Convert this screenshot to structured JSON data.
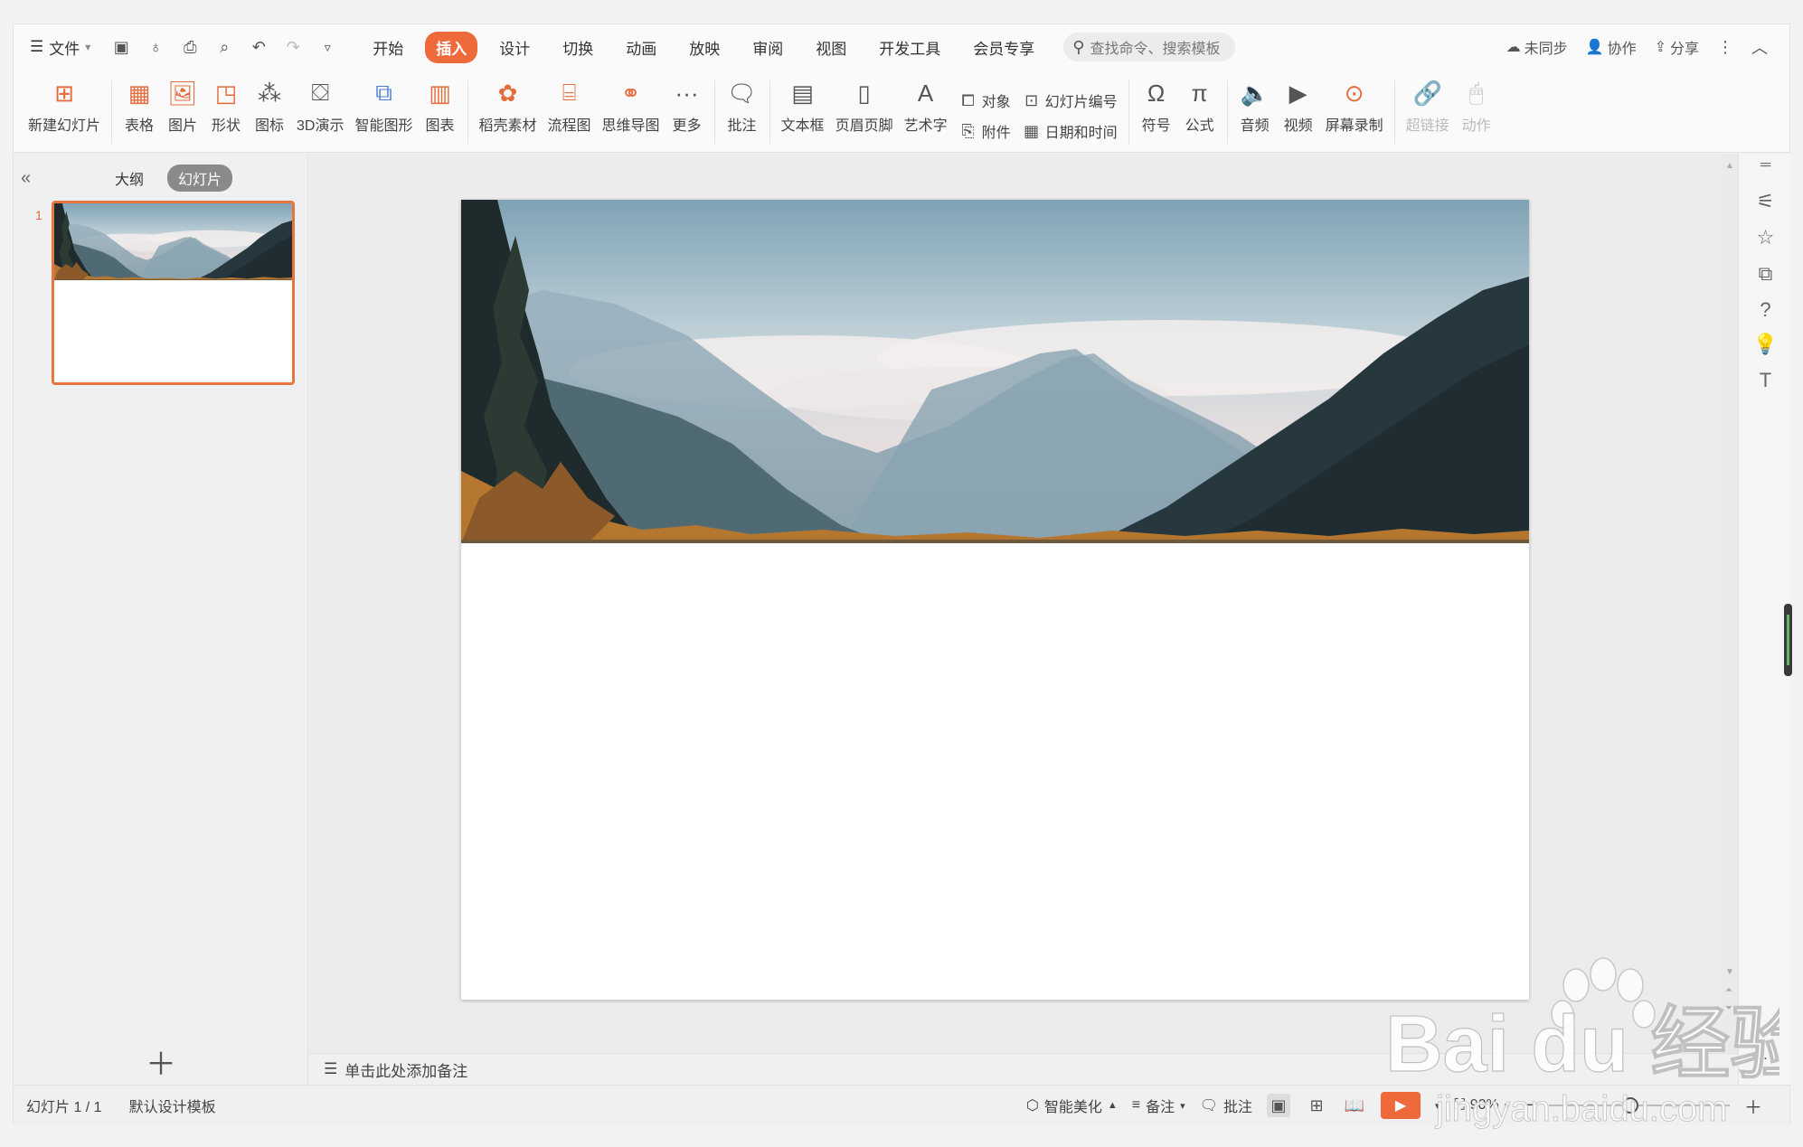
{
  "menu": {
    "file": "文件",
    "tabs": [
      {
        "label": "开始",
        "active": false
      },
      {
        "label": "插入",
        "active": true
      },
      {
        "label": "设计",
        "active": false
      },
      {
        "label": "切换",
        "active": false
      },
      {
        "label": "动画",
        "active": false
      },
      {
        "label": "放映",
        "active": false
      },
      {
        "label": "审阅",
        "active": false
      },
      {
        "label": "视图",
        "active": false
      },
      {
        "label": "开发工具",
        "active": false
      },
      {
        "label": "会员专享",
        "active": false
      }
    ],
    "search_placeholder": "查找命令、搜索模板",
    "sync": "未同步",
    "collab": "协作",
    "share": "分享"
  },
  "ribbon": {
    "new_slide": "新建幻灯片",
    "table": "表格",
    "picture": "图片",
    "shape": "形状",
    "icons": "图标",
    "demo3d": "3D演示",
    "smartart": "智能图形",
    "chart": "图表",
    "material": "稻壳素材",
    "flowchart": "流程图",
    "mindmap": "思维导图",
    "more": "更多",
    "comment": "批注",
    "textbox": "文本框",
    "header_footer": "页眉页脚",
    "wordart": "艺术字",
    "object": "对象",
    "attachment": "附件",
    "slide_number": "幻灯片编号",
    "datetime": "日期和时间",
    "symbol": "符号",
    "formula": "公式",
    "audio": "音频",
    "video": "视频",
    "screen_record": "屏幕录制",
    "hyperlink": "超链接",
    "action": "动作"
  },
  "left_panel": {
    "outline_tab": "大纲",
    "slides_tab": "幻灯片",
    "slide_number": "1"
  },
  "notes": {
    "placeholder": "单击此处添加备注"
  },
  "status": {
    "slide_counter": "幻灯片 1 / 1",
    "template": "默认设计模板",
    "beautify": "智能美化",
    "notes": "备注",
    "comment": "批注",
    "zoom": "90%",
    "zoom_fraction": 0.45
  },
  "watermark": {
    "brand": "Bai du 经验",
    "url": "jingyan.baidu.com"
  },
  "colors": {
    "accent": "#ee6a3b",
    "thumb_border": "#e8753f"
  }
}
